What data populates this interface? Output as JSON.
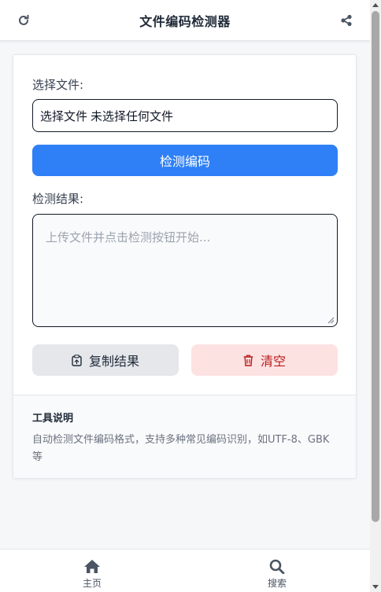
{
  "header": {
    "title": "文件编码检测器",
    "refresh_icon": "refresh-icon",
    "share_icon": "share-icon"
  },
  "form": {
    "file_label": "选择文件:",
    "file_button": "选择文件",
    "file_status": "未选择任何文件",
    "detect_button": "检测编码",
    "result_label": "检测结果:",
    "result_placeholder": "上传文件并点击检测按钮开始..."
  },
  "actions": {
    "copy_label": "复制结果",
    "clear_label": "清空"
  },
  "info": {
    "title": "工具说明",
    "description": "自动检测文件编码格式，支持多种常见编码识别，如UTF-8、GBK等"
  },
  "nav": {
    "home_label": "主页",
    "search_label": "搜索"
  },
  "colors": {
    "primary": "#2f80f6",
    "danger_bg": "#fde2e2",
    "danger_text": "#b91c1c",
    "neutral_bg": "#e5e7eb"
  }
}
